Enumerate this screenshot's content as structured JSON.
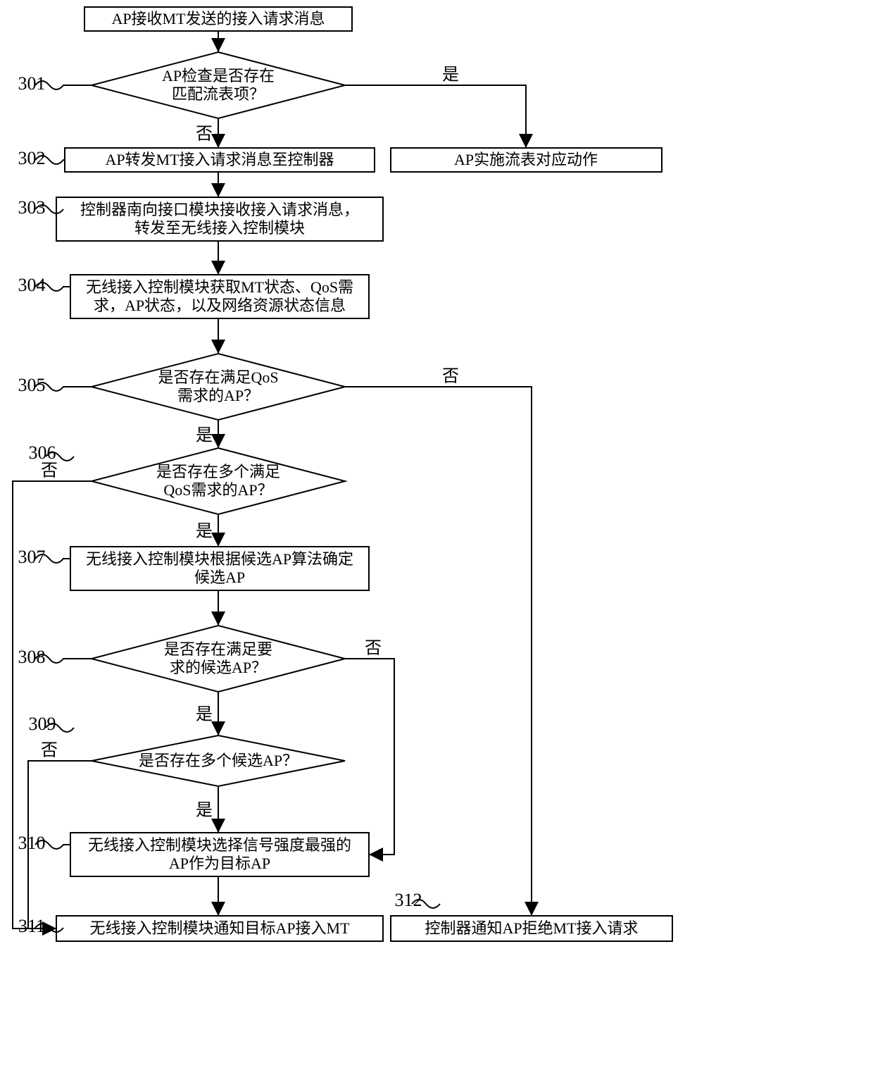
{
  "steps": {
    "s300": "AP接收MT发送的接入请求消息",
    "s301": {
      "line1": "AP检查是否存在",
      "line2": "匹配流表项？"
    },
    "s302": "AP转发MT接入请求消息至控制器",
    "s302b": "AP实施流表对应动作",
    "s303": {
      "line1": "控制器南向接口模块接收接入请求消息，",
      "line2": "转发至无线接入控制模块"
    },
    "s304": {
      "line1": "无线接入控制模块获取MT状态、QoS需",
      "line2": "求，AP状态，以及网络资源状态信息"
    },
    "s305": {
      "line1": "是否存在满足QoS",
      "line2": "需求的AP？"
    },
    "s306": {
      "line1": "是否存在多个满足",
      "line2": "QoS需求的AP？"
    },
    "s307": {
      "line1": "无线接入控制模块根据候选AP算法确定",
      "line2": "候选AP"
    },
    "s308": {
      "line1": "是否存在满足要",
      "line2": "求的候选AP？"
    },
    "s309": "是否存在多个候选AP？",
    "s310": {
      "line1": "无线接入控制模块选择信号强度最强的",
      "line2": "AP作为目标AP"
    },
    "s311": "无线接入控制模块通知目标AP接入MT",
    "s312": "控制器通知AP拒绝MT接入请求"
  },
  "labels": {
    "n301": "301",
    "n302": "302",
    "n303": "303",
    "n304": "304",
    "n305": "305",
    "n306": "306",
    "n307": "307",
    "n308": "308",
    "n309": "309",
    "n310": "310",
    "n311": "311",
    "n312": "312"
  },
  "edges": {
    "yes": "是",
    "no": "否"
  }
}
